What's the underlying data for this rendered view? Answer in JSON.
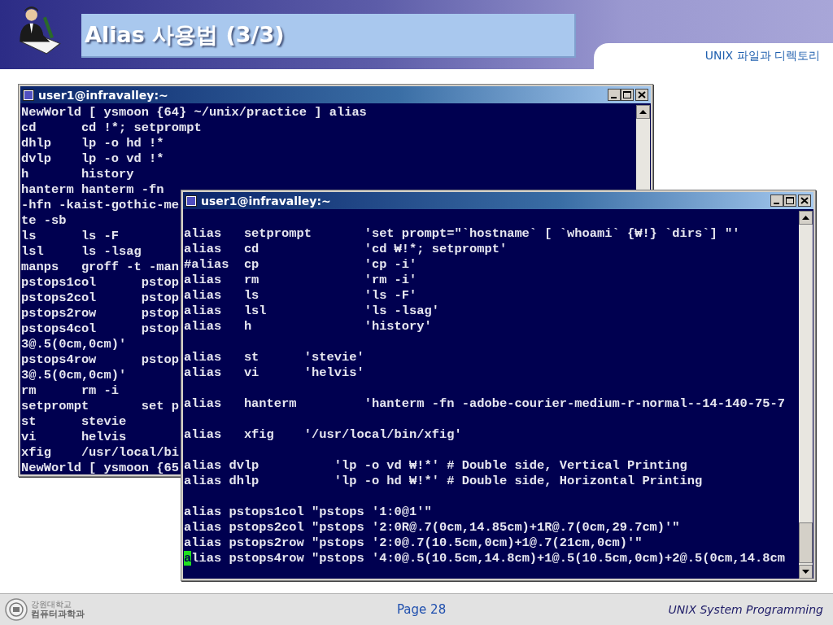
{
  "header": {
    "title": "Alias 사용법 (3/3)",
    "section": "UNIX 파일과 디렉토리"
  },
  "windows": [
    {
      "title": "user1@infravalley:~",
      "lines": [
        {
          "text": "NewWorld [ ysmoon {64} ~/unix/practice ] alias",
          "blank_before": false,
          "cursor": false
        },
        {
          "text": "cd      cd !*; setprompt",
          "blank_before": false,
          "cursor": false
        },
        {
          "text": "dhlp    lp -o hd !*",
          "blank_before": false,
          "cursor": false
        },
        {
          "text": "dvlp    lp -o vd !*",
          "blank_before": false,
          "cursor": false
        },
        {
          "text": "h       history",
          "blank_before": false,
          "cursor": false
        },
        {
          "text": "hanterm hanterm -fn",
          "blank_before": false,
          "cursor": false
        },
        {
          "text": "-hfn -kaist-gothic-me",
          "blank_before": false,
          "cursor": false
        },
        {
          "text": "te -sb",
          "blank_before": false,
          "cursor": false
        },
        {
          "text": "ls      ls -F",
          "blank_before": false,
          "cursor": false
        },
        {
          "text": "lsl     ls -lsag",
          "blank_before": false,
          "cursor": false
        },
        {
          "text": "manps   groff -t -man",
          "blank_before": false,
          "cursor": false
        },
        {
          "text": "pstops1col      pstop",
          "blank_before": false,
          "cursor": false
        },
        {
          "text": "pstops2col      pstop",
          "blank_before": false,
          "cursor": false
        },
        {
          "text": "pstops2row      pstop",
          "blank_before": false,
          "cursor": false
        },
        {
          "text": "pstops4col      pstop",
          "blank_before": false,
          "cursor": false
        },
        {
          "text": "3@.5(0cm,0cm)'",
          "blank_before": false,
          "cursor": false
        },
        {
          "text": "pstops4row      pstop",
          "blank_before": false,
          "cursor": false
        },
        {
          "text": "3@.5(0cm,0cm)'",
          "blank_before": false,
          "cursor": false
        },
        {
          "text": "rm      rm -i",
          "blank_before": false,
          "cursor": false
        },
        {
          "text": "setprompt       set p",
          "blank_before": false,
          "cursor": false
        },
        {
          "text": "st      stevie",
          "blank_before": false,
          "cursor": false
        },
        {
          "text": "vi      helvis",
          "blank_before": false,
          "cursor": false
        },
        {
          "text": "xfig    /usr/local/bi",
          "blank_before": false,
          "cursor": false
        },
        {
          "text": "NewWorld [ ysmoon {65",
          "blank_before": false,
          "cursor": false
        }
      ]
    },
    {
      "title": "user1@infravalley:~",
      "lines": [
        {
          "text": "alias   setprompt       'set prompt=\"`hostname` [ `whoami` {₩!} `dirs`] \"'",
          "blank_before": true,
          "cursor": false
        },
        {
          "text": "alias   cd              'cd ₩!*; setprompt'",
          "blank_before": false,
          "cursor": false
        },
        {
          "text": "#alias  cp              'cp -i'",
          "blank_before": false,
          "cursor": false
        },
        {
          "text": "alias   rm              'rm -i'",
          "blank_before": false,
          "cursor": false
        },
        {
          "text": "alias   ls              'ls -F'",
          "blank_before": false,
          "cursor": false
        },
        {
          "text": "alias   lsl             'ls -lsag'",
          "blank_before": false,
          "cursor": false
        },
        {
          "text": "alias   h               'history'",
          "blank_before": false,
          "cursor": false
        },
        {
          "text": "alias   st      'stevie'",
          "blank_before": true,
          "cursor": false
        },
        {
          "text": "alias   vi      'helvis'",
          "blank_before": false,
          "cursor": false
        },
        {
          "text": "alias   hanterm         'hanterm -fn -adobe-courier-medium-r-normal--14-140-75-7",
          "blank_before": true,
          "cursor": false
        },
        {
          "text": "alias   xfig    '/usr/local/bin/xfig'",
          "blank_before": true,
          "cursor": false
        },
        {
          "text": "alias dvlp          'lp -o vd ₩!*' # Double side, Vertical Printing",
          "blank_before": true,
          "cursor": false
        },
        {
          "text": "alias dhlp          'lp -o hd ₩!*' # Double side, Horizontal Printing",
          "blank_before": false,
          "cursor": false
        },
        {
          "text": "alias pstops1col \"pstops '1:0@1'\"",
          "blank_before": true,
          "cursor": false
        },
        {
          "text": "alias pstops2col \"pstops '2:0R@.7(0cm,14.85cm)+1R@.7(0cm,29.7cm)'\"",
          "blank_before": false,
          "cursor": false
        },
        {
          "text": "alias pstops2row \"pstops '2:0@.7(10.5cm,0cm)+1@.7(21cm,0cm)'\"",
          "blank_before": false,
          "cursor": false
        },
        {
          "text": "alias pstops4row \"pstops '4:0@.5(10.5cm,14.8cm)+1@.5(10.5cm,0cm)+2@.5(0cm,14.8cm",
          "blank_before": false,
          "cursor": true
        }
      ]
    }
  ],
  "footer": {
    "logo_lines": [
      "강원대학교",
      "컴퓨터과학과"
    ],
    "page": "Page 28",
    "course": "UNIX System Programming"
  }
}
